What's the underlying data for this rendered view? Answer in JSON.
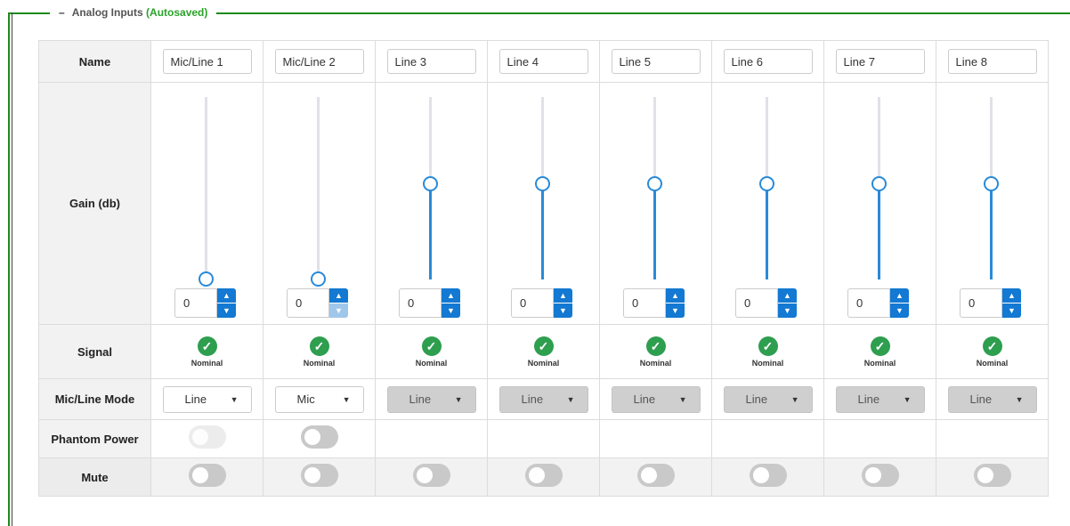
{
  "section": {
    "collapse_glyph": "–",
    "title": "Analog Inputs",
    "status": "(Autosaved)",
    "accent_color": "#2aa22a"
  },
  "row_labels": {
    "name": "Name",
    "gain": "Gain (db)",
    "signal": "Signal",
    "mode": "Mic/Line Mode",
    "phantom": "Phantom Power",
    "mute": "Mute"
  },
  "icons": {
    "spin_up": "caret-up-icon",
    "spin_down": "caret-down-icon",
    "signal": "check-circle-icon",
    "dropdown": "caret-down-icon"
  },
  "channels": [
    {
      "name": "Mic/Line 1",
      "gain_value": "0",
      "gain_level": 0.0,
      "down_disabled": false,
      "signal": "Nominal",
      "mode": "Line",
      "mode_disabled": false,
      "phantom": "off",
      "phantom_faded": true,
      "mute": "off"
    },
    {
      "name": "Mic/Line 2",
      "gain_value": "0",
      "gain_level": 0.0,
      "down_disabled": true,
      "signal": "Nominal",
      "mode": "Mic",
      "mode_disabled": false,
      "phantom": "off",
      "phantom_faded": false,
      "mute": "off"
    },
    {
      "name": "Line 3",
      "gain_value": "0",
      "gain_level": 0.52,
      "down_disabled": false,
      "signal": "Nominal",
      "mode": "Line",
      "mode_disabled": true,
      "phantom": null,
      "mute": "off"
    },
    {
      "name": "Line 4",
      "gain_value": "0",
      "gain_level": 0.52,
      "down_disabled": false,
      "signal": "Nominal",
      "mode": "Line",
      "mode_disabled": true,
      "phantom": null,
      "mute": "off"
    },
    {
      "name": "Line 5",
      "gain_value": "0",
      "gain_level": 0.52,
      "down_disabled": false,
      "signal": "Nominal",
      "mode": "Line",
      "mode_disabled": true,
      "phantom": null,
      "mute": "off"
    },
    {
      "name": "Line 6",
      "gain_value": "0",
      "gain_level": 0.52,
      "down_disabled": false,
      "signal": "Nominal",
      "mode": "Line",
      "mode_disabled": true,
      "phantom": null,
      "mute": "off"
    },
    {
      "name": "Line 7",
      "gain_value": "0",
      "gain_level": 0.52,
      "down_disabled": false,
      "signal": "Nominal",
      "mode": "Line",
      "mode_disabled": true,
      "phantom": null,
      "mute": "off"
    },
    {
      "name": "Line 8",
      "gain_value": "0",
      "gain_level": 0.52,
      "down_disabled": false,
      "signal": "Nominal",
      "mode": "Line",
      "mode_disabled": true,
      "phantom": null,
      "mute": "off"
    }
  ]
}
